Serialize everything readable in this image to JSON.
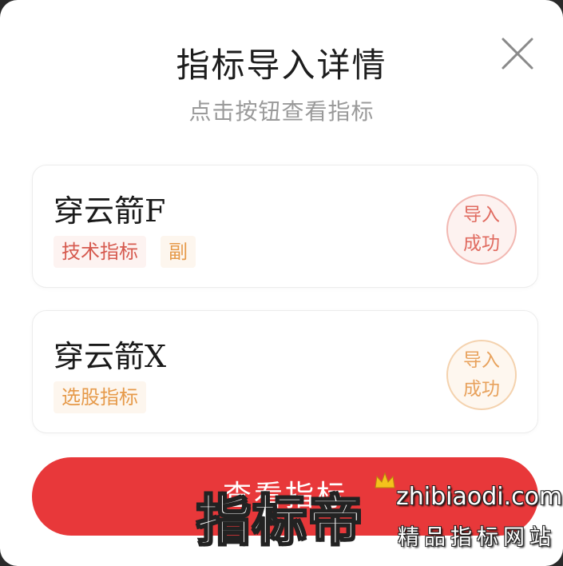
{
  "dialog": {
    "title": "指标导入详情",
    "subtitle": "点击按钮查看指标",
    "close_icon": "close-icon"
  },
  "indicators": [
    {
      "name": "穿云箭F",
      "tags": [
        "技术指标",
        "副"
      ],
      "status_line1": "导入",
      "status_line2": "成功",
      "accent": "#e06b60"
    },
    {
      "name": "穿云箭X",
      "tags": [
        "选股指标"
      ],
      "status_line1": "导入",
      "status_line2": "成功",
      "accent": "#e8a25d"
    }
  ],
  "action": {
    "label": "查看指标",
    "color": "#e8383a"
  },
  "watermark": {
    "main": "指标帝",
    "domain": "zhibiaodi.com",
    "slogan": "精品指标网站",
    "icon": "crown-icon"
  }
}
